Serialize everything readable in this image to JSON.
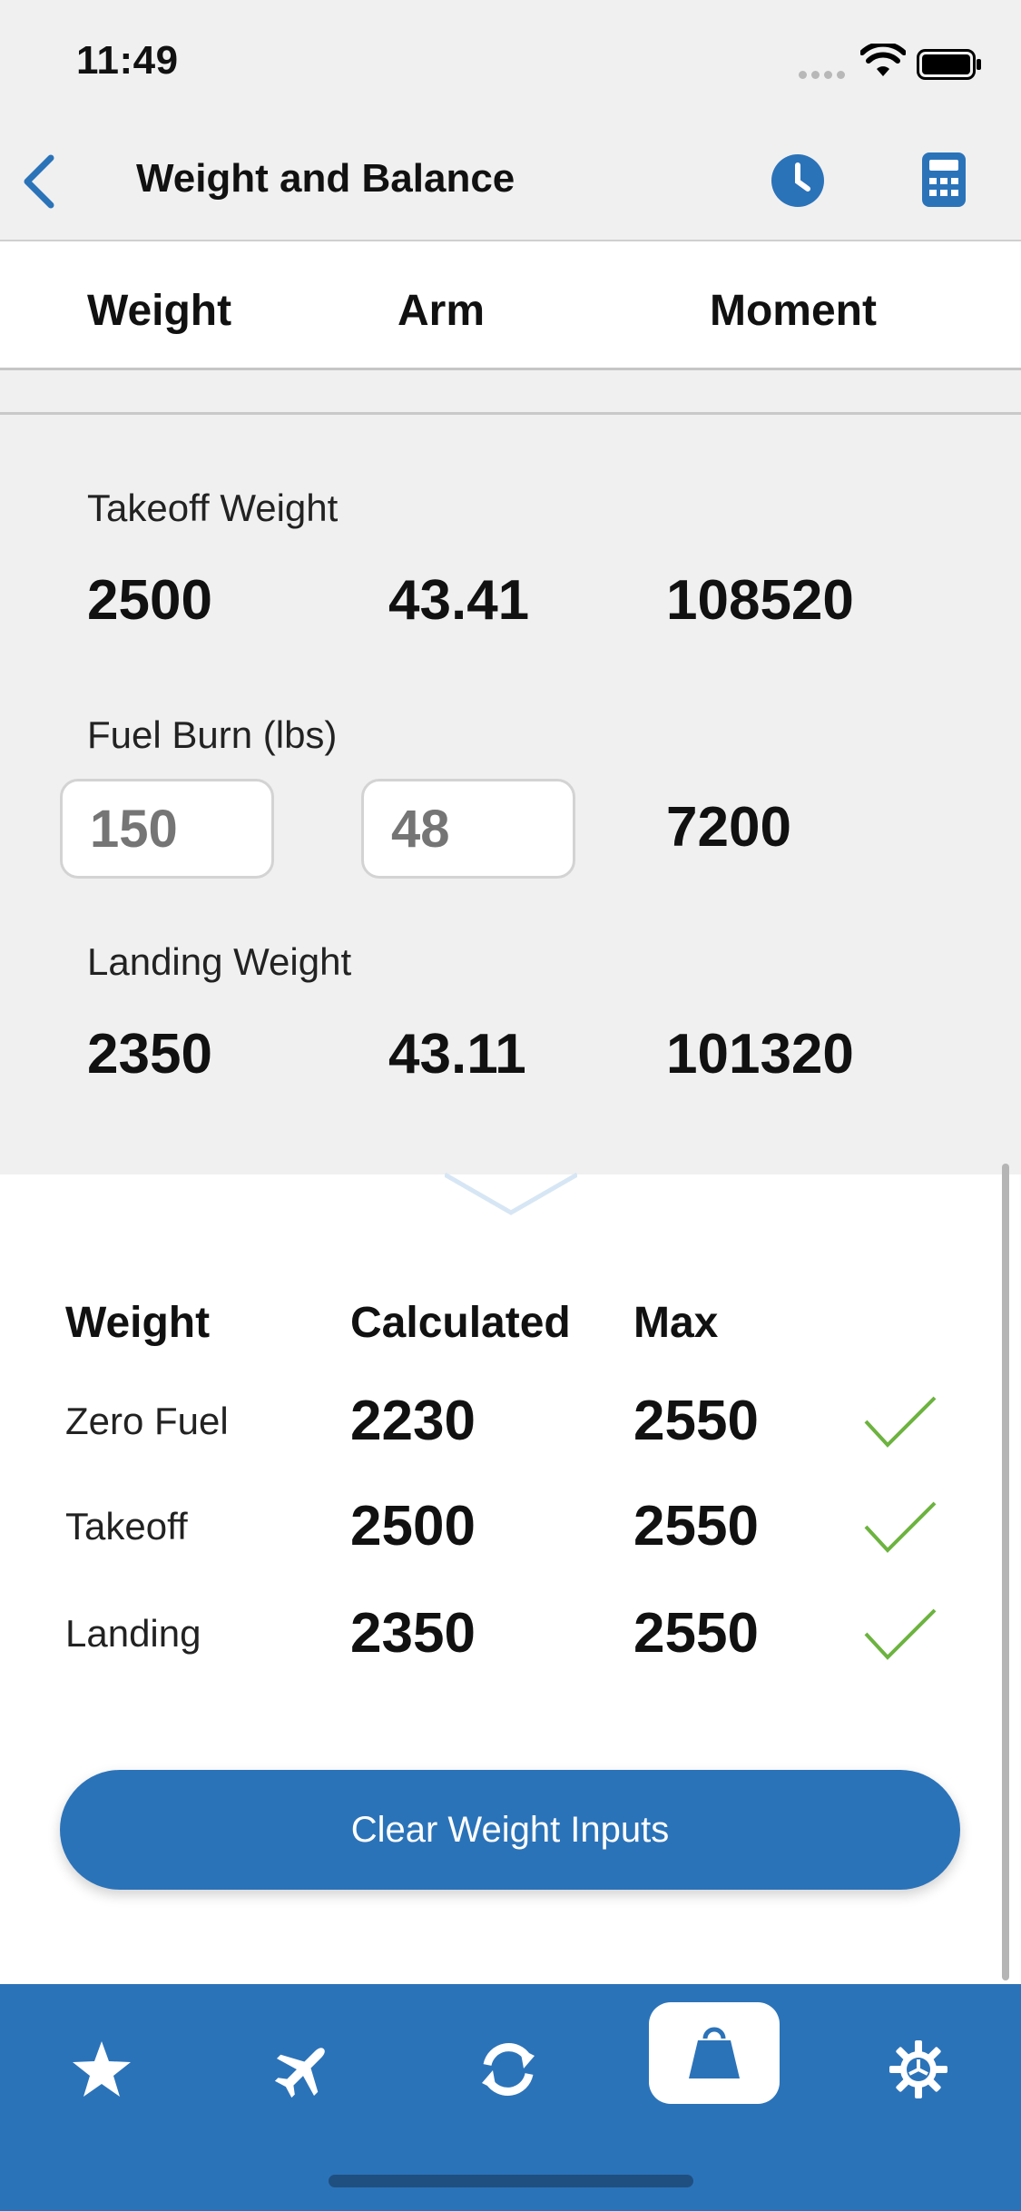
{
  "status": {
    "time": "11:49"
  },
  "nav": {
    "title": "Weight and Balance"
  },
  "columns": {
    "weight": "Weight",
    "arm": "Arm",
    "moment": "Moment"
  },
  "rows": {
    "takeoff": {
      "label": "Takeoff Weight",
      "weight": "2500",
      "arm": "43.41",
      "moment": "108520"
    },
    "fuel_burn": {
      "label": "Fuel Burn (lbs)",
      "weight_placeholder": "150",
      "arm_placeholder": "48",
      "moment": "7200"
    },
    "landing": {
      "label": "Landing Weight",
      "weight": "2350",
      "arm": "43.11",
      "moment": "101320"
    }
  },
  "limits": {
    "headers": {
      "weight": "Weight",
      "calculated": "Calculated",
      "max": "Max"
    },
    "rows": [
      {
        "label": "Zero Fuel",
        "calculated": "2230",
        "max": "2550",
        "ok": true
      },
      {
        "label": "Takeoff",
        "calculated": "2500",
        "max": "2550",
        "ok": true
      },
      {
        "label": "Landing",
        "calculated": "2350",
        "max": "2550",
        "ok": true
      }
    ]
  },
  "clear_button": "Clear Weight Inputs",
  "tabs": [
    {
      "icon": "star-icon",
      "active": false
    },
    {
      "icon": "airplane-icon",
      "active": false
    },
    {
      "icon": "refresh-icon",
      "active": false
    },
    {
      "icon": "weight-icon",
      "active": true
    },
    {
      "icon": "gear-icon",
      "active": false
    }
  ],
  "colors": {
    "accent": "#2b73b9",
    "check": "#6cb33f",
    "input_text": "#8fb8de"
  }
}
